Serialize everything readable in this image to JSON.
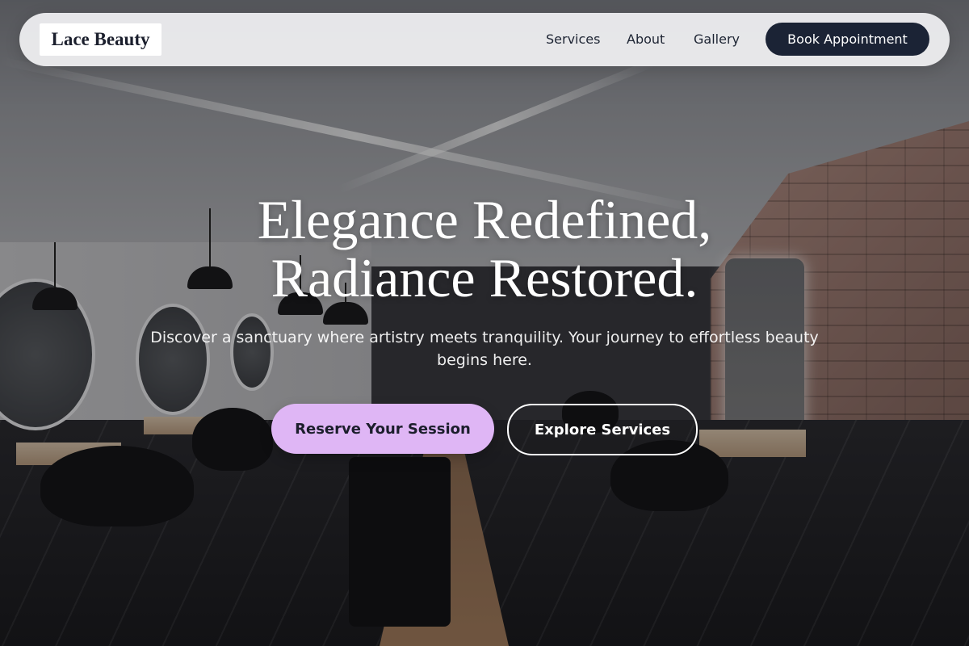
{
  "brand": {
    "name": "Lace Beauty"
  },
  "nav": {
    "links": [
      "Services",
      "About",
      "Gallery"
    ],
    "cta_label": "Book Appointment"
  },
  "hero": {
    "title_line1": "Elegance Redefined,",
    "title_line2": "Radiance Restored.",
    "subtitle": "Discover a sanctuary where artistry meets tranquility. Your journey to effortless beauty begins here.",
    "primary_cta": "Reserve Your Session",
    "secondary_cta": "Explore Services"
  },
  "colors": {
    "primary_button": "#dfb6f5",
    "nav_cta": "#1b2335",
    "text_dark": "#1d2433"
  }
}
